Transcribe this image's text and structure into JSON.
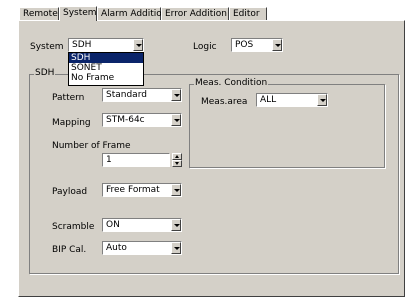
{
  "tabs": [
    {
      "label": "Remote"
    },
    {
      "label": "System"
    },
    {
      "label": "Alarm Addition"
    },
    {
      "label": "Error Addition"
    },
    {
      "label": "Editor"
    }
  ],
  "active_tab": "System",
  "system": {
    "label": "System",
    "value": "SDH",
    "options": [
      "SDH",
      "SONET",
      "No Frame"
    ],
    "highlighted_option": "SDH"
  },
  "logic": {
    "label": "Logic",
    "value": "POS"
  },
  "sdh_group": {
    "title": "SDH",
    "pattern": {
      "label": "Pattern",
      "value": "Standard"
    },
    "mapping": {
      "label": "Mapping",
      "value": "STM-64c"
    },
    "number_of_frame": {
      "label": "Number of Frame",
      "value": "1"
    },
    "payload": {
      "label": "Payload",
      "value": "Free Format"
    },
    "scramble": {
      "label": "Scramble",
      "value": "ON"
    },
    "bip_cal": {
      "label": "BIP Cal.",
      "value": "Auto"
    }
  },
  "meas_condition": {
    "title": "Meas. Condition",
    "meas_area": {
      "label": "Meas.area",
      "value": "ALL"
    }
  },
  "colors": {
    "panel": "#d4d0c8",
    "selection": "#0a246a",
    "field": "#ffffff"
  }
}
